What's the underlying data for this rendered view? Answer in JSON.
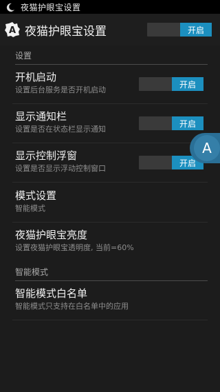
{
  "status_bar": {
    "title": "夜猫护眼宝设置"
  },
  "action_bar": {
    "title": "夜猫护眼宝设置",
    "switch_label": "开启"
  },
  "sections": [
    {
      "header": "设置",
      "items": [
        {
          "title": "开机启动",
          "subtitle": "设置后台服务是否开机启动",
          "switch_label": "开启"
        },
        {
          "title": "显示通知栏",
          "subtitle": "设置是否在状态栏显示通知",
          "switch_label": "开启"
        },
        {
          "title": "显示控制浮窗",
          "subtitle": "设置是否显示浮动控制窗口",
          "switch_label": "开启"
        },
        {
          "title": "模式设置",
          "subtitle": "智能模式"
        },
        {
          "title": "夜猫护眼宝亮度",
          "subtitle": "设置夜猫护眼宝透明度, 当前=60%"
        }
      ]
    },
    {
      "header": "智能模式",
      "items": [
        {
          "title": "智能模式白名单",
          "subtitle": "智能模式只支持在白名单中的应用"
        }
      ]
    }
  ],
  "floating_button": {
    "label": "A"
  },
  "colors": {
    "accent": "#1c8fbf",
    "background": "#1c1c1c",
    "switch_track": "#3a3a3a"
  }
}
